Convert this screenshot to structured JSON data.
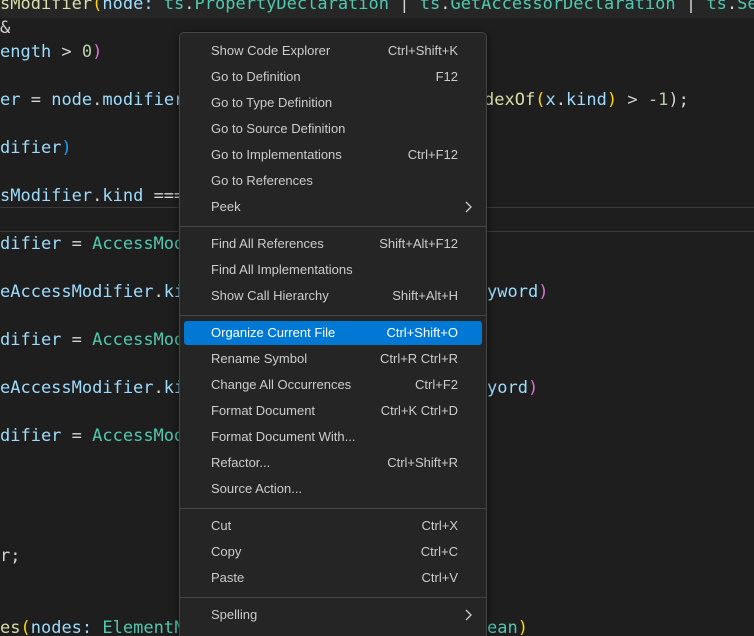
{
  "editor": {
    "lines": [
      {
        "tokens": [
          [
            "sModifier",
            "fn"
          ],
          [
            "(",
            "br2"
          ],
          [
            "node: ",
            "var"
          ],
          [
            "ts",
            "type"
          ],
          [
            ".",
            "op"
          ],
          [
            "PropertyDeclaration",
            "type"
          ],
          [
            " | ",
            "op"
          ],
          [
            "ts",
            "type"
          ],
          [
            ".",
            "op"
          ],
          [
            "GetAccessorDeclaration",
            "type"
          ],
          [
            " | ",
            "op"
          ],
          [
            "ts",
            "type"
          ],
          [
            ".",
            "op"
          ],
          [
            "SetA",
            "type"
          ]
        ]
      },
      {
        "tokens": [
          [
            "&",
            "op"
          ]
        ]
      },
      {
        "tokens": [
          [
            "ength",
            "var"
          ],
          [
            " > ",
            "op"
          ],
          [
            "0",
            "num"
          ],
          [
            ")",
            "br1"
          ]
        ]
      },
      {
        "tokens": [
          [
            "er",
            "var"
          ],
          [
            " = ",
            "op"
          ],
          [
            "node",
            "var"
          ],
          [
            ".",
            "op"
          ],
          [
            "modifiers",
            "var"
          ],
          [
            "dexOf",
            "fn"
          ],
          [
            "(",
            "br2"
          ],
          [
            "x",
            "var"
          ],
          [
            ".",
            "op"
          ],
          [
            "kind",
            "var"
          ],
          [
            ")",
            "br2"
          ],
          [
            " > ",
            "op"
          ],
          [
            "-1",
            "num"
          ],
          [
            ");",
            "op"
          ]
        ]
      },
      {
        "tokens": [
          [
            "difier",
            "var"
          ],
          [
            ")",
            "br3"
          ]
        ]
      },
      {
        "tokens": [
          [
            "sModifier",
            "var"
          ],
          [
            ".",
            "op"
          ],
          [
            "kind",
            "var"
          ],
          [
            " ===",
            "op"
          ]
        ]
      },
      {
        "tokens": [
          [
            "difier",
            "var"
          ],
          [
            " = ",
            "op"
          ],
          [
            "AccessModi",
            "type"
          ]
        ]
      },
      {
        "tokens": [
          [
            "eAccessModifier",
            "var"
          ],
          [
            ".",
            "op"
          ],
          [
            "kin",
            "var"
          ],
          [
            "yword",
            "var"
          ],
          [
            ")",
            "br1"
          ]
        ]
      },
      {
        "tokens": [
          [
            "difier",
            "var"
          ],
          [
            " = ",
            "op"
          ],
          [
            "AccessModi",
            "type"
          ]
        ]
      },
      {
        "tokens": [
          [
            "eAccessModifier",
            "var"
          ],
          [
            ".",
            "op"
          ],
          [
            "kin",
            "var"
          ],
          [
            "yord",
            "var"
          ],
          [
            ")",
            "br1"
          ]
        ]
      },
      {
        "tokens": [
          [
            "difier",
            "var"
          ],
          [
            " = ",
            "op"
          ],
          [
            "AccessModi",
            "type"
          ]
        ]
      },
      {
        "tokens": [
          [
            "r;",
            "op"
          ]
        ]
      },
      {
        "tokens": [
          [
            "es",
            "fn"
          ],
          [
            "(",
            "br2"
          ],
          [
            "nodes: ",
            "var"
          ],
          [
            "ElementNo",
            "type"
          ],
          [
            "ean",
            "type"
          ],
          [
            ")",
            "br2"
          ]
        ]
      }
    ]
  },
  "context_menu": {
    "groups": [
      [
        {
          "label": "Show Code Explorer",
          "shortcut": "Ctrl+Shift+K",
          "submenu": false,
          "selected": false
        },
        {
          "label": "Go to Definition",
          "shortcut": "F12",
          "submenu": false,
          "selected": false
        },
        {
          "label": "Go to Type Definition",
          "shortcut": "",
          "submenu": false,
          "selected": false
        },
        {
          "label": "Go to Source Definition",
          "shortcut": "",
          "submenu": false,
          "selected": false
        },
        {
          "label": "Go to Implementations",
          "shortcut": "Ctrl+F12",
          "submenu": false,
          "selected": false
        },
        {
          "label": "Go to References",
          "shortcut": "",
          "submenu": false,
          "selected": false
        },
        {
          "label": "Peek",
          "shortcut": "",
          "submenu": true,
          "selected": false
        }
      ],
      [
        {
          "label": "Find All References",
          "shortcut": "Shift+Alt+F12",
          "submenu": false,
          "selected": false
        },
        {
          "label": "Find All Implementations",
          "shortcut": "",
          "submenu": false,
          "selected": false
        },
        {
          "label": "Show Call Hierarchy",
          "shortcut": "Shift+Alt+H",
          "submenu": false,
          "selected": false
        }
      ],
      [
        {
          "label": "Organize Current File",
          "shortcut": "Ctrl+Shift+O",
          "submenu": false,
          "selected": true
        },
        {
          "label": "Rename Symbol",
          "shortcut": "Ctrl+R Ctrl+R",
          "submenu": false,
          "selected": false
        },
        {
          "label": "Change All Occurrences",
          "shortcut": "Ctrl+F2",
          "submenu": false,
          "selected": false
        },
        {
          "label": "Format Document",
          "shortcut": "Ctrl+K Ctrl+D",
          "submenu": false,
          "selected": false
        },
        {
          "label": "Format Document With...",
          "shortcut": "",
          "submenu": false,
          "selected": false
        },
        {
          "label": "Refactor...",
          "shortcut": "Ctrl+Shift+R",
          "submenu": false,
          "selected": false
        },
        {
          "label": "Source Action...",
          "shortcut": "",
          "submenu": false,
          "selected": false
        }
      ],
      [
        {
          "label": "Cut",
          "shortcut": "Ctrl+X",
          "submenu": false,
          "selected": false
        },
        {
          "label": "Copy",
          "shortcut": "Ctrl+C",
          "submenu": false,
          "selected": false
        },
        {
          "label": "Paste",
          "shortcut": "Ctrl+V",
          "submenu": false,
          "selected": false
        }
      ],
      [
        {
          "label": "Spelling",
          "shortcut": "",
          "submenu": true,
          "selected": false
        }
      ]
    ]
  },
  "colors": {
    "selection": "#0078d4",
    "menu_background": "#252526",
    "editor_background": "#1e1e1e"
  }
}
